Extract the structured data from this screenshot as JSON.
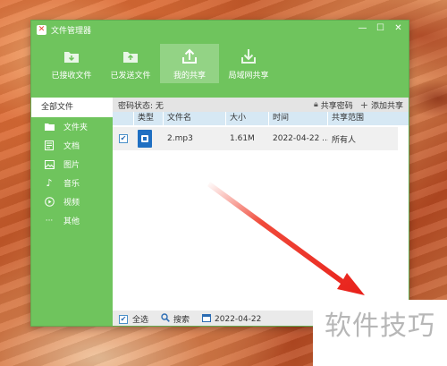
{
  "window": {
    "title": "文件管理器",
    "logo_char": "✕"
  },
  "toolbar": [
    {
      "label": "已接收文件",
      "icon": "inbox-icon"
    },
    {
      "label": "已发送文件",
      "icon": "outbox-icon"
    },
    {
      "label": "我的共享",
      "icon": "upload-icon",
      "active": true
    },
    {
      "label": "局域网共享",
      "icon": "download-icon"
    }
  ],
  "sidebar": {
    "header": "全部文件",
    "items": [
      {
        "label": "文件夹",
        "icon": "folder-icon"
      },
      {
        "label": "文档",
        "icon": "document-icon"
      },
      {
        "label": "图片",
        "icon": "image-icon"
      },
      {
        "label": "音乐",
        "icon": "music-icon"
      },
      {
        "label": "视频",
        "icon": "video-icon"
      },
      {
        "label": "其他",
        "icon": "more-icon"
      }
    ]
  },
  "status": {
    "password_status": "密码状态: 无",
    "share_password": "共享密码",
    "add_share": "添加共享"
  },
  "table": {
    "headers": [
      "类型",
      "文件名",
      "大小",
      "时间",
      "共享范围"
    ],
    "rows": [
      {
        "checked": true,
        "name": "2.mp3",
        "size": "1.61M",
        "time": "2022-04-22 ...",
        "scope": "所有人"
      }
    ]
  },
  "bottom": {
    "select_all": "全选",
    "search": "搜索",
    "date": "2022-04-22"
  },
  "watermark": "软件技巧",
  "colors": {
    "accent_green": "#6fc45d",
    "header_blue": "#d6e8f4",
    "arrow_red": "#e8201a"
  }
}
